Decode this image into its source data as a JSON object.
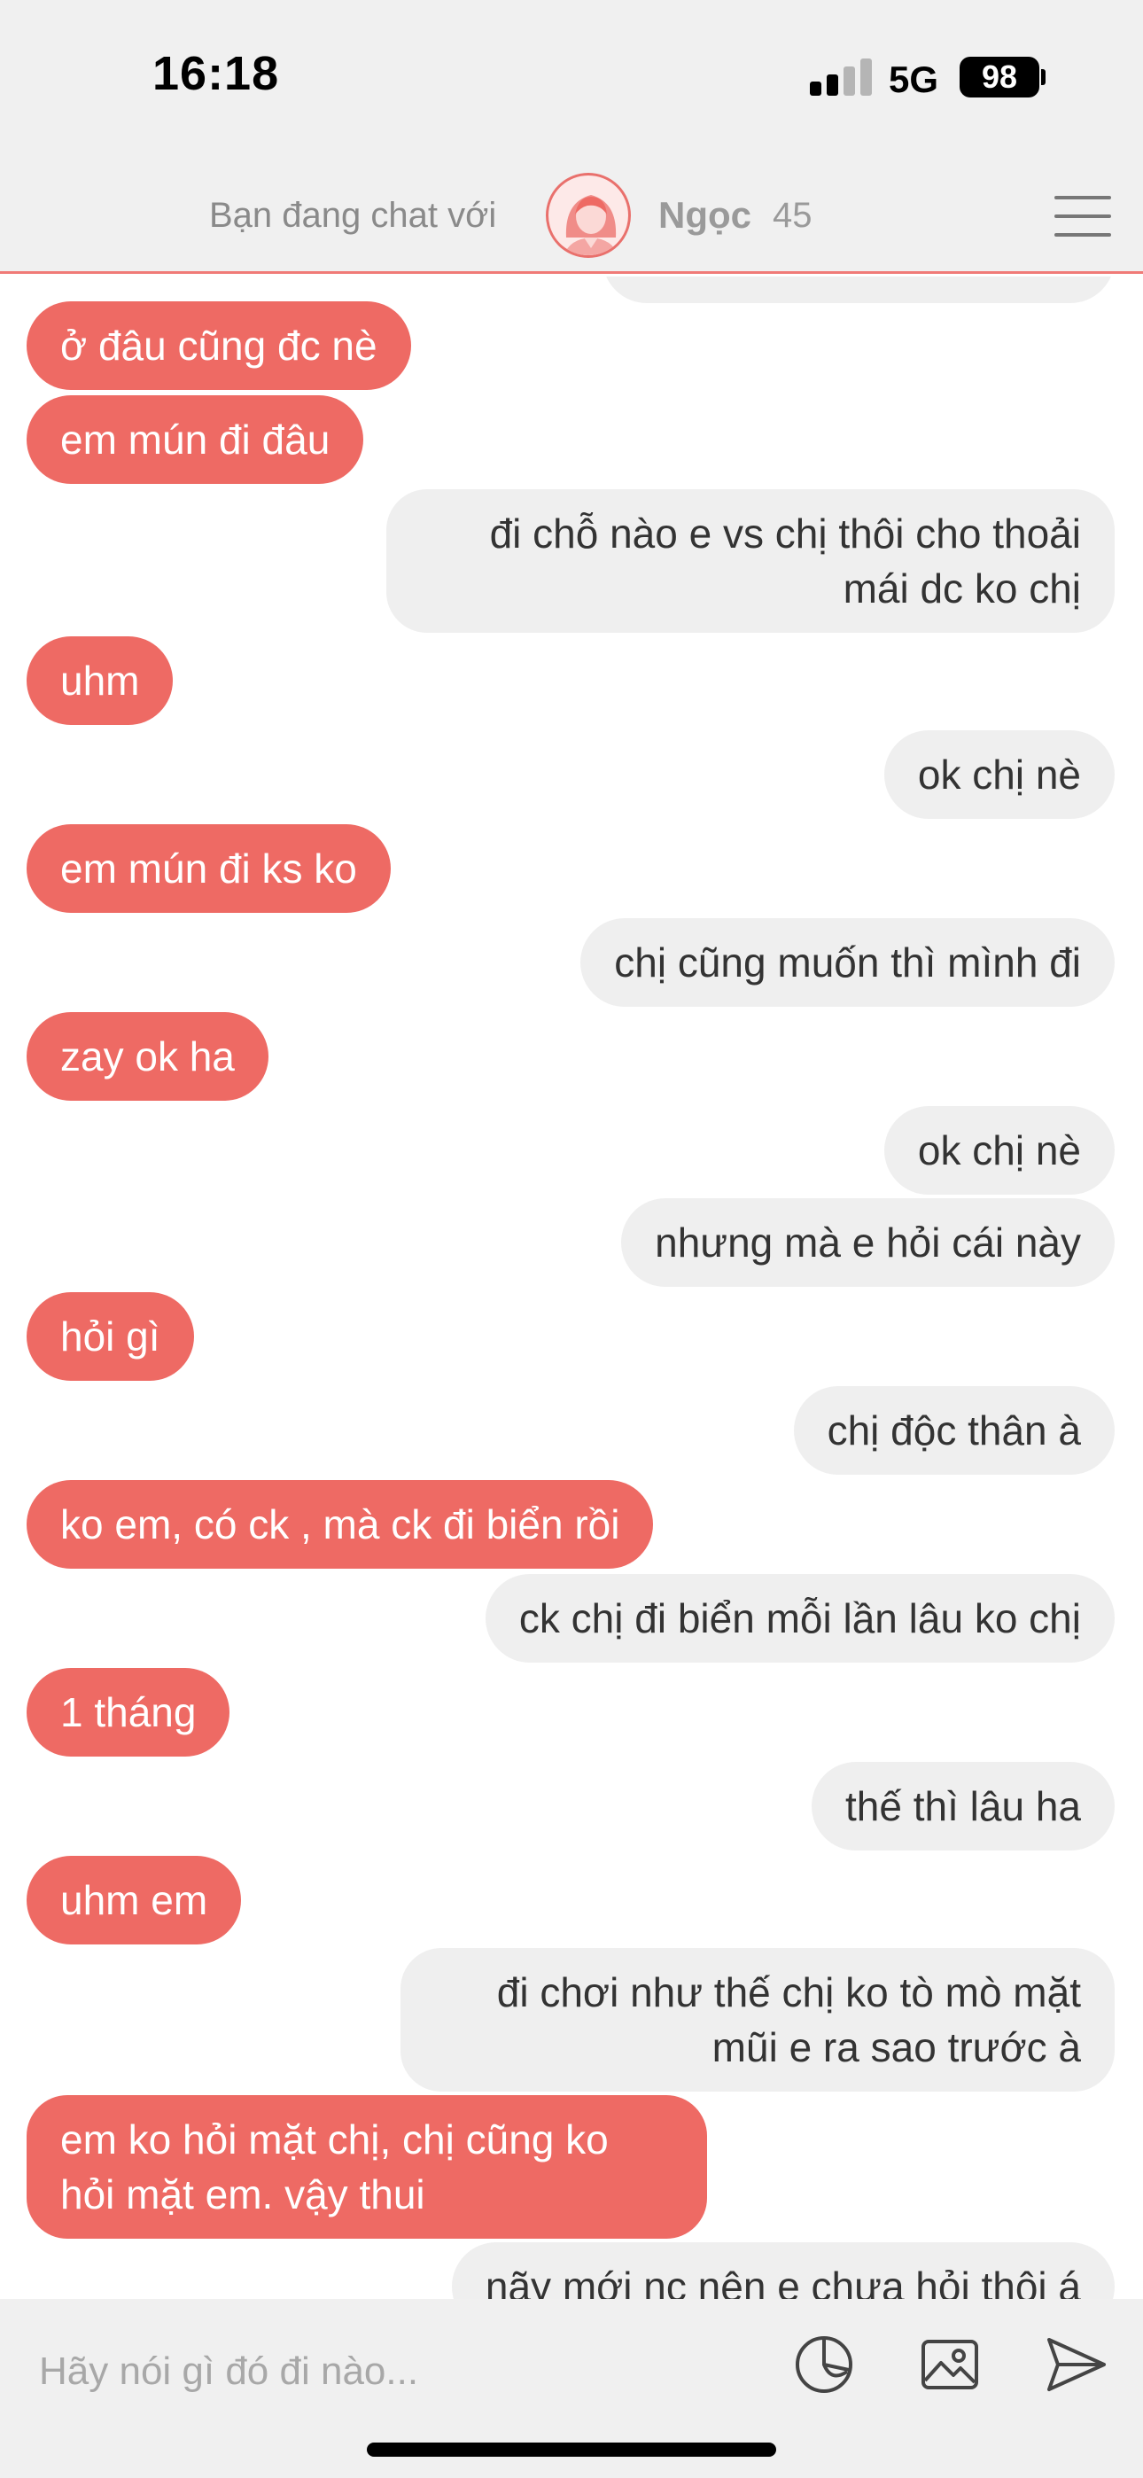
{
  "status_bar": {
    "time": "16:18",
    "network": "5G",
    "battery": "98"
  },
  "header": {
    "prefix": "Bạn đang chat với",
    "name": "Ngọc",
    "age": "45",
    "avatar_icon": "female-avatar-icon",
    "menu_icon": "hamburger-menu-icon"
  },
  "colors": {
    "accent": "#ee6a64",
    "their_bubble": "#ee6a64",
    "my_bubble": "#efefef",
    "header_bg": "#f0f0f0"
  },
  "messages": [
    {
      "from": "them",
      "text": "ở đâu cũng đc nè"
    },
    {
      "from": "them",
      "text": "em mún đi đâu"
    },
    {
      "from": "me",
      "text": "đi chỗ nào e vs chị thôi cho thoải mái dc ko chị"
    },
    {
      "from": "them",
      "text": "uhm"
    },
    {
      "from": "me",
      "text": "ok chị nè"
    },
    {
      "from": "them",
      "text": "em mún đi ks ko"
    },
    {
      "from": "me",
      "text": "chị cũng muốn thì mình đi"
    },
    {
      "from": "them",
      "text": "zay ok ha"
    },
    {
      "from": "me",
      "text": "ok chị nè"
    },
    {
      "from": "me",
      "text": "nhưng mà e hỏi cái này"
    },
    {
      "from": "them",
      "text": "hỏi gì"
    },
    {
      "from": "me",
      "text": "chị độc thân à"
    },
    {
      "from": "them",
      "text": "ko em, có ck , mà ck đi biển rồi"
    },
    {
      "from": "me",
      "text": "ck chị đi biển mỗi lần lâu ko chị"
    },
    {
      "from": "them",
      "text": "1 tháng"
    },
    {
      "from": "me",
      "text": "thế thì lâu ha"
    },
    {
      "from": "them",
      "text": "uhm em"
    },
    {
      "from": "me",
      "text": "đi chơi như thế chị ko tò mò mặt mũi e ra sao trước à"
    },
    {
      "from": "them",
      "text": "em ko hỏi mặt chị, chị cũng ko hỏi mặt em. vậy thui"
    },
    {
      "from": "me",
      "text": "nãy mới nc nên e chưa hỏi thôi á"
    }
  ],
  "input": {
    "placeholder": "Hãy nói gì đó đi nào...",
    "value": "",
    "sticker_icon": "sticker-icon",
    "image_icon": "image-icon",
    "send_icon": "send-icon"
  }
}
